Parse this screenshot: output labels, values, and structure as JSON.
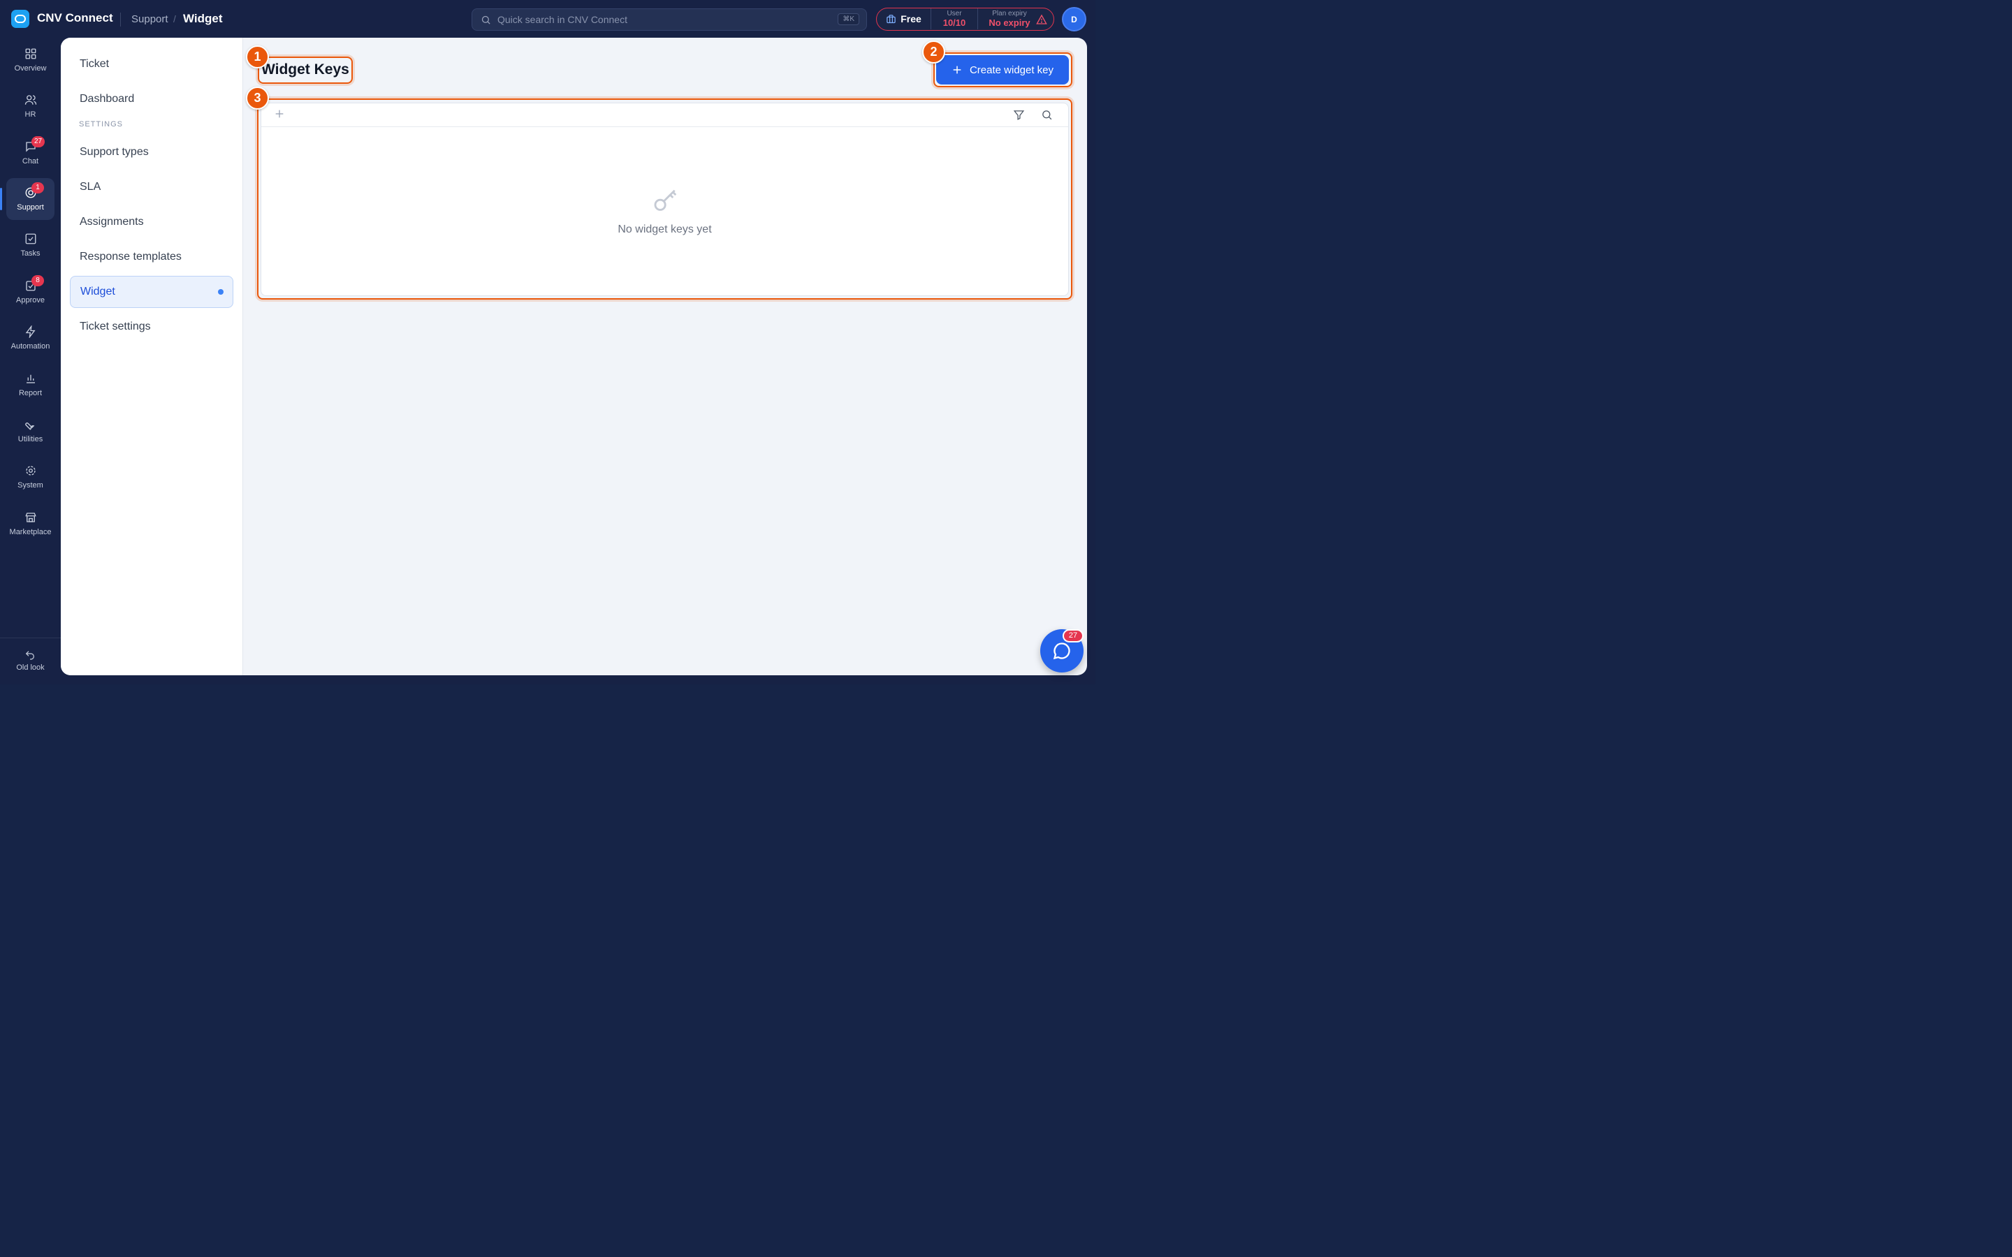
{
  "app": {
    "title": "CNV Connect"
  },
  "breadcrumb": {
    "parent": "Support",
    "separator": "/",
    "current": "Widget"
  },
  "search": {
    "placeholder": "Quick search in CNV Connect",
    "shortcut": "⌘K"
  },
  "plan": {
    "name": "Free",
    "user_label": "User",
    "user_value": "10/10",
    "expiry_label": "Plan expiry",
    "expiry_value": "No expiry"
  },
  "avatar": {
    "initial": "D"
  },
  "rail": {
    "items": [
      {
        "label": "Overview",
        "icon": "grid-icon"
      },
      {
        "label": "HR",
        "icon": "users-icon"
      },
      {
        "label": "Chat",
        "icon": "chat-icon",
        "badge": "27"
      },
      {
        "label": "Support",
        "icon": "support-icon",
        "badge": "1",
        "active": true
      },
      {
        "label": "Tasks",
        "icon": "checkbox-icon"
      },
      {
        "label": "Approve",
        "icon": "approve-icon",
        "badge": "8"
      },
      {
        "label": "Automation",
        "icon": "bolt-icon"
      },
      {
        "label": "Report",
        "icon": "bar-chart-icon"
      },
      {
        "label": "Utilities",
        "icon": "wrench-icon"
      },
      {
        "label": "System",
        "icon": "gear-icon"
      },
      {
        "label": "Marketplace",
        "icon": "store-icon"
      }
    ],
    "bottom": {
      "label": "Old look",
      "icon": "undo-icon"
    }
  },
  "subnav": {
    "items": [
      {
        "label": "Ticket"
      },
      {
        "label": "Dashboard"
      }
    ],
    "section": "SETTINGS",
    "settings_items": [
      {
        "label": "Support types"
      },
      {
        "label": "SLA"
      },
      {
        "label": "Assignments"
      },
      {
        "label": "Response templates"
      },
      {
        "label": "Widget",
        "active": true
      },
      {
        "label": "Ticket settings"
      }
    ]
  },
  "main": {
    "title": "Widget Keys",
    "create_button": "Create widget key",
    "empty_text": "No widget keys yet"
  },
  "annotations": [
    "1",
    "2",
    "3"
  ],
  "fab": {
    "badge": "27"
  },
  "colors": {
    "accent": "#2563eb",
    "highlight": "#ea580c",
    "badge": "#e5364f",
    "sidebar": "#172245"
  }
}
